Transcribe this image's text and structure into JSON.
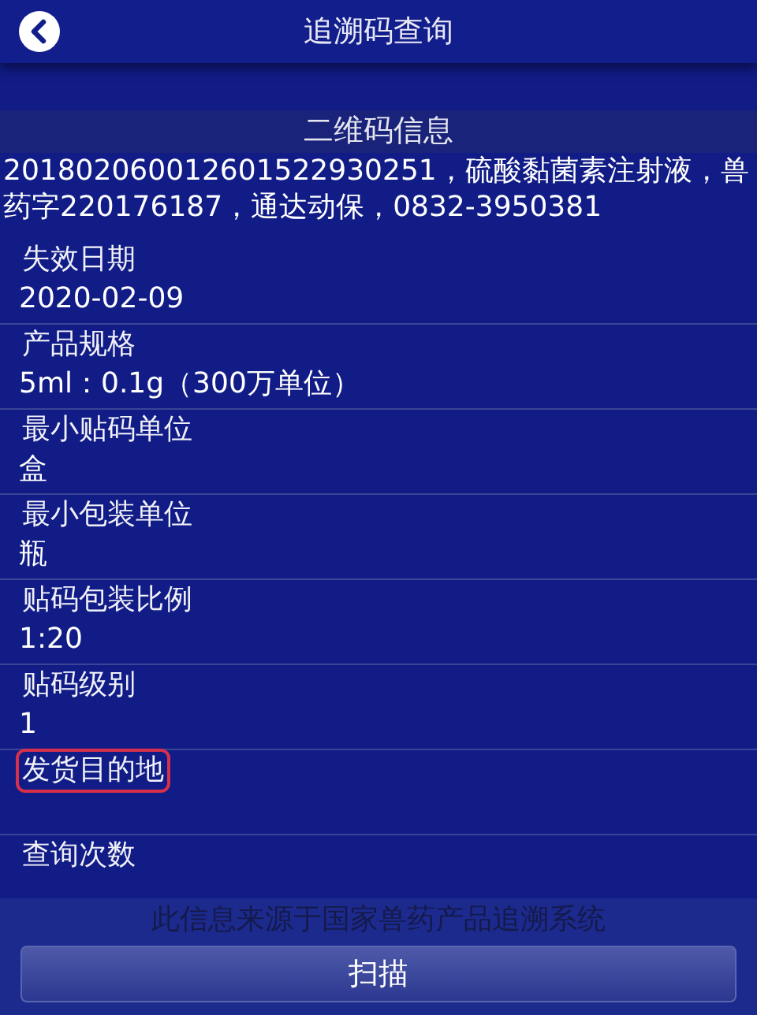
{
  "header": {
    "title": "追溯码查询"
  },
  "section": {
    "title": "二维码信息",
    "description": "201802060012601522930251，硫酸黏菌素注射液，兽药字220176187，通达动保，0832-3950381"
  },
  "fields": [
    {
      "label": "失效日期",
      "value": "2020-02-09",
      "highlighted": false
    },
    {
      "label": "产品规格",
      "value": "5ml：0.1g（300万单位）",
      "highlighted": false
    },
    {
      "label": "最小贴码单位",
      "value": "盒",
      "highlighted": false
    },
    {
      "label": "最小包装单位",
      "value": "瓶",
      "highlighted": false
    },
    {
      "label": "贴码包装比例",
      "value": "1:20",
      "highlighted": false
    },
    {
      "label": "贴码级别",
      "value": "1",
      "highlighted": false
    },
    {
      "label": "发货目的地",
      "highlighted": true
    },
    {
      "label": "查询次数",
      "highlighted": false
    }
  ],
  "footer": {
    "note": "此信息来源于国家兽药产品追溯系统",
    "button": "扫描"
  }
}
